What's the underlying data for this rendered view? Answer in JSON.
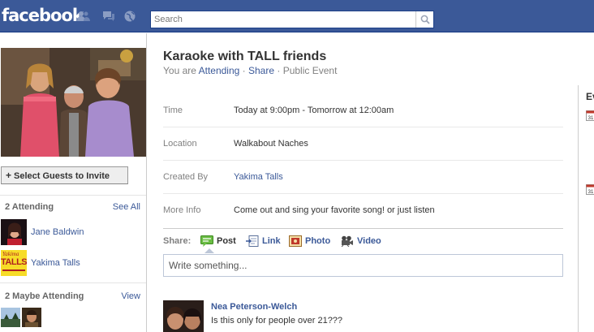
{
  "header": {
    "logo": "facebook",
    "search_placeholder": "Search",
    "jewels": [
      "friend-requests-icon",
      "messages-icon",
      "notifications-globe-icon"
    ],
    "colors": {
      "bar": "#3b5998",
      "link": "#3b5998"
    }
  },
  "sidebar": {
    "select_guests_label": "Select Guests to Invite",
    "attending": {
      "title": "2 Attending",
      "link": "See All",
      "guests": [
        {
          "name": "Jane Baldwin"
        },
        {
          "name": "Yakima Talls",
          "thumb_text_top": "Yakima",
          "thumb_text_main": "TALLS"
        }
      ]
    },
    "maybe": {
      "title": "2 Maybe Attending",
      "link": "View"
    }
  },
  "event": {
    "title": "Karaoke with TALL friends",
    "subtitle_prefix": "You are ",
    "rsvp_status": "Attending",
    "sep1": " · ",
    "share_link": "Share",
    "sep2": " · ",
    "privacy": "Public Event",
    "details": [
      {
        "label": "Time",
        "value": "Today at 9:00pm - Tomorrow at 12:00am"
      },
      {
        "label": "Location",
        "value": "Walkabout Naches"
      },
      {
        "label": "Created By",
        "value": "Yakima Talls"
      },
      {
        "label": "More Info",
        "value": "Come out and sing your favorite song! or just listen"
      }
    ]
  },
  "share": {
    "label": "Share:",
    "items": [
      {
        "label": "Post",
        "icon": "post-icon"
      },
      {
        "label": "Link",
        "icon": "link-icon"
      },
      {
        "label": "Photo",
        "icon": "photo-icon"
      },
      {
        "label": "Video",
        "icon": "video-camera-icon"
      }
    ],
    "composer_placeholder": "Write something..."
  },
  "wall": {
    "posts": [
      {
        "author": "Nea Peterson-Welch",
        "text": "Is this only for people over 21???"
      }
    ]
  },
  "right_column": {
    "heading": "Ev",
    "calendar_icon_text": "31"
  }
}
